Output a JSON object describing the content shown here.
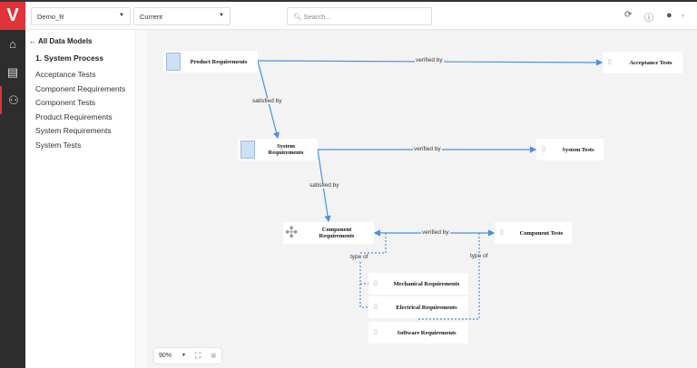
{
  "header": {
    "project_select": "Demo_R",
    "version_select": "Current",
    "search_placeholder": "Search...",
    "icons": [
      "refresh-icon",
      "help-icon",
      "user-icon"
    ]
  },
  "rail": {
    "logo": "V",
    "icons": [
      "home-icon",
      "document-icon",
      "diagram-icon"
    ]
  },
  "sidebar": {
    "back_label": "All Data Models",
    "process": "1. System Process",
    "items": [
      {
        "label": "Acceptance Tests"
      },
      {
        "label": "Component Requirements"
      },
      {
        "label": "Component Tests"
      },
      {
        "label": "Product Requirements"
      },
      {
        "label": "System Requirements"
      },
      {
        "label": "System Tests"
      }
    ]
  },
  "diagram": {
    "nodes": {
      "pr": "Product Requirements",
      "at": "Acceptance Tests",
      "sr": "System Requirements",
      "st": "System Tests",
      "cr": "Component Requirements",
      "ct": "Component Tests",
      "mr": "Mechanical Requirements",
      "er": "Electrical Requirements",
      "sw": "Software Requirements"
    },
    "edges": {
      "pr_at": "verified by",
      "pr_sr": "satisfied by",
      "sr_st": "verified by",
      "sr_cr": "satisfied by",
      "cr_ct": "verified by",
      "type1": "type of",
      "type2": "type of"
    },
    "edge_color": "#4a90e2"
  },
  "zoom": {
    "level": "90%"
  }
}
